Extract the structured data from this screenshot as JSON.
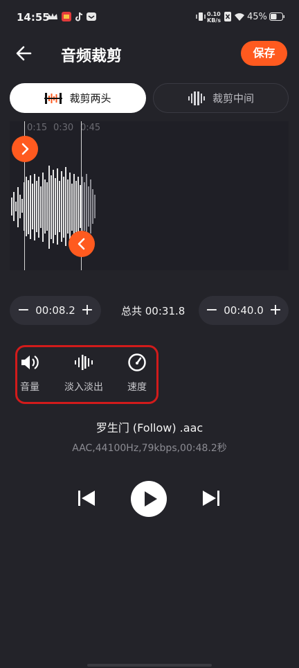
{
  "status_bar": {
    "time": "14:55",
    "net_speed_top": "0.10",
    "net_speed_bottom": "KB/s",
    "battery": "45%"
  },
  "header": {
    "title": "音频裁剪",
    "save_label": "保存"
  },
  "tabs": [
    {
      "label": "裁剪两头",
      "active": true
    },
    {
      "label": "裁剪中间",
      "active": false
    }
  ],
  "waveform": {
    "ticks": [
      "0:15",
      "0:30",
      "0:45"
    ]
  },
  "trim": {
    "start": "00:08.2",
    "end": "00:40.0",
    "total": "总共 00:31.8",
    "minus": "−",
    "plus": "+"
  },
  "tools": [
    {
      "label": "音量",
      "icon": "volume-icon"
    },
    {
      "label": "淡入淡出",
      "icon": "fade-icon"
    },
    {
      "label": "速度",
      "icon": "speed-icon"
    }
  ],
  "file": {
    "name": "罗生门 (Follow) .aac",
    "info": "AAC,44100Hz,79kbps,00:48.2秒"
  },
  "colors": {
    "accent": "#ff5a1f",
    "background": "#232329",
    "highlight_box": "#d21b1b"
  }
}
